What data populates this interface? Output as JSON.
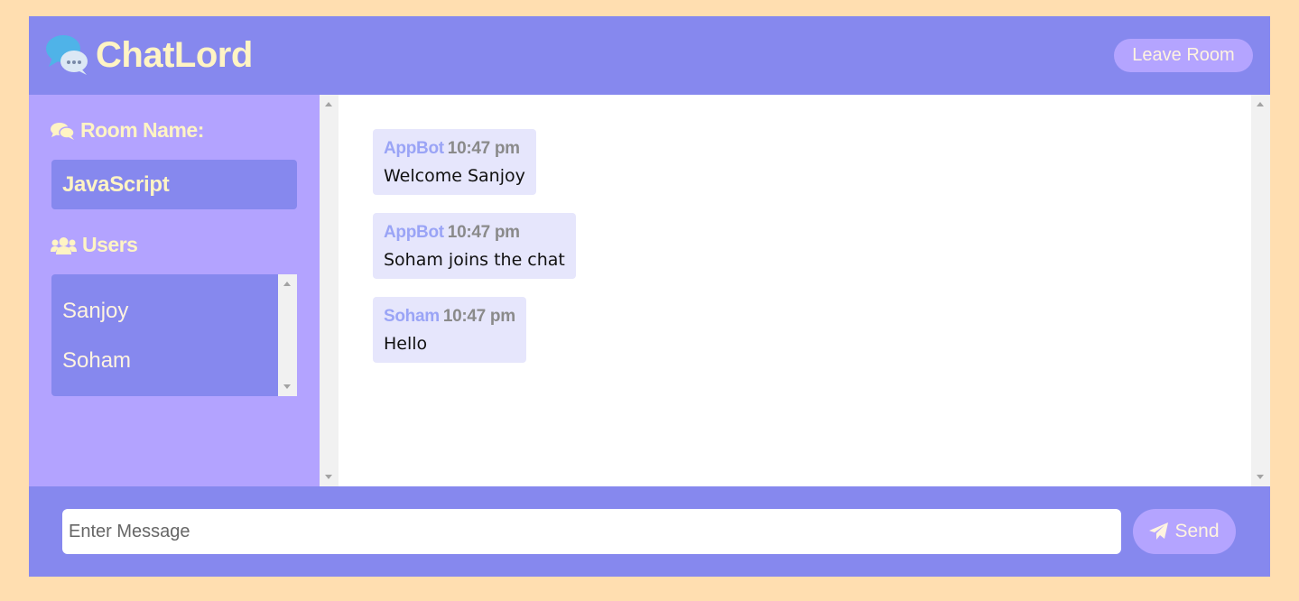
{
  "app": {
    "title": "ChatLord"
  },
  "header": {
    "leave_label": "Leave Room"
  },
  "sidebar": {
    "room_heading": "Room Name:",
    "room_name": "JavaScript",
    "users_heading": "Users",
    "users": [
      "Sanjoy",
      "Soham"
    ]
  },
  "messages": [
    {
      "author": "AppBot",
      "time": "10:47 pm",
      "text": "Welcome Sanjoy"
    },
    {
      "author": "AppBot",
      "time": "10:47 pm",
      "text": "Soham joins the chat"
    },
    {
      "author": "Soham",
      "time": "10:47 pm",
      "text": "Hello"
    }
  ],
  "composer": {
    "placeholder": "Enter Message",
    "value": "",
    "send_label": "Send"
  },
  "colors": {
    "background": "#FFDEB0",
    "primary": "#8688EE",
    "sidebar": "#B3A3FF",
    "accent_text": "#FFF4C4",
    "message_bg": "#E6E6FC",
    "author": "#9AA4F6"
  },
  "icons": {
    "logo": "chat-bubbles-icon",
    "room": "comments-icon",
    "users": "users-icon",
    "send": "paper-plane-icon"
  }
}
